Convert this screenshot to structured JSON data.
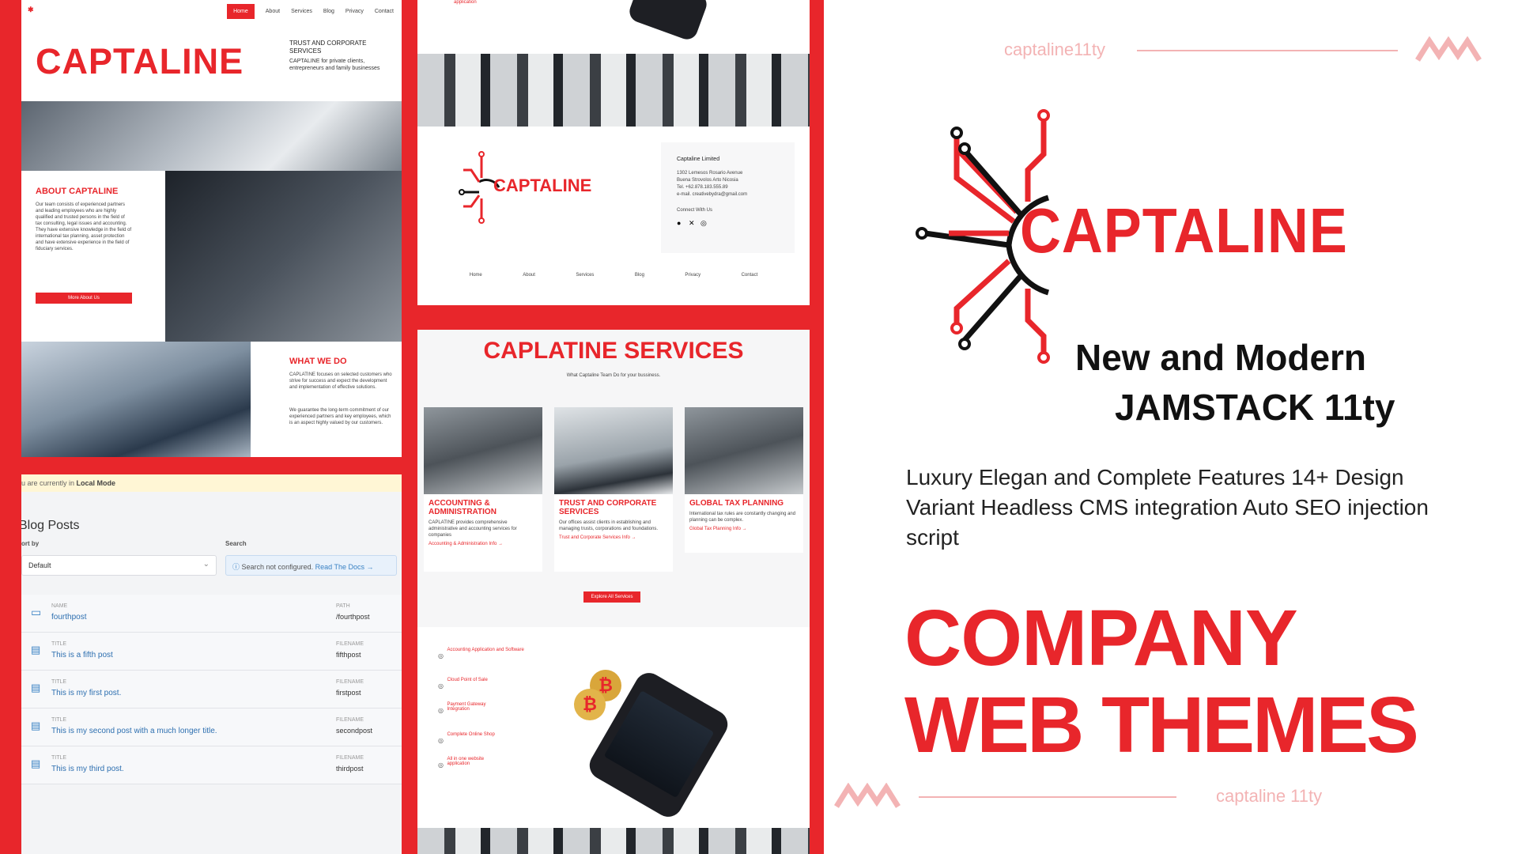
{
  "colors": {
    "brand_red": "#e8262b",
    "faded_red": "#f3b3b4"
  },
  "panel_a": {
    "nav": [
      "Home",
      "About",
      "Services",
      "Blog",
      "Privacy",
      "Contact"
    ],
    "logo_text": "CAPTALINE",
    "trust_title": "TRUST AND CORPORATE SERVICES",
    "trust_sub": "CAPTALINE for private clients, entrepreneurs and family businesses",
    "about_title": "ABOUT CAPTALINE",
    "about_body": "Our team consists of experienced partners and leading employees who are highly qualified and trusted persons in the field of tax consulting, legal issues and accounting. They have extensive knowledge in the field of international tax planning, asset protection and have extensive experience in the field of fiduciary services.",
    "about_button": "More About Us",
    "what_title": "WHAT WE DO",
    "what_body1": "CAPLATINE focuses on selected customers who strive for success and expect the development and implementation of effective solutions.",
    "what_body2": "We guarantee the long-term commitment of our experienced partners and key employees, which is an aspect highly valued by our customers."
  },
  "cms": {
    "notice_prefix": "u are currently in",
    "notice_mode": "Local Mode",
    "heading": "Blog Posts",
    "sort_label": "ort by",
    "sort_value": "Default",
    "search_label": "Search",
    "search_status": "Search not configured.",
    "search_link": "Read The Docs",
    "rows": [
      {
        "k1": "NAME",
        "v1": "fourthpost",
        "k2": "PATH",
        "v2": "/fourthpost",
        "icon": "folder-icon"
      },
      {
        "k1": "TITLE",
        "v1": "This is a fifth post",
        "k2": "FILENAME",
        "v2": "fifthpost",
        "icon": "document-icon"
      },
      {
        "k1": "TITLE",
        "v1": "This is my first post.",
        "k2": "FILENAME",
        "v2": "firstpost",
        "icon": "document-icon"
      },
      {
        "k1": "TITLE",
        "v1": "This is my second post with a much longer title.",
        "k2": "FILENAME",
        "v2": "secondpost",
        "icon": "document-icon"
      },
      {
        "k1": "TITLE",
        "v1": "This is my third post.",
        "k2": "FILENAME",
        "v2": "thirdpost",
        "icon": "document-icon"
      }
    ]
  },
  "panel_b": {
    "top_caption": "application",
    "footer_logo": "CAPTALINE",
    "company": "Captaline Limited",
    "address1": "1302 Lemesos Rosario Avenue",
    "address2": "Buena Strovolos Arto Nicosia",
    "tel": "Tel. +62.878.183.555.89",
    "email": "e-mail. creativebydra@gmail.com",
    "connect": "Connect With Us",
    "footer_nav": [
      "Home",
      "About",
      "Services",
      "Blog",
      "Privacy",
      "Contact"
    ]
  },
  "panel_c": {
    "title": "CAPLATINE SERVICES",
    "subtitle": "What Captaline Team Do for your bussiness.",
    "cards": [
      {
        "title": "ACCOUNTING & ADMINISTRATION",
        "body": "CAPLATINE provides comprehensive administrative and accounting services for companies",
        "link": "Accounting & Administration Info →"
      },
      {
        "title": "TRUST AND CORPORATE SERVICES",
        "body": "Our offices assist clients in establishing and managing trusts, corporations and foundations.",
        "link": "Trust and Corporate Services Info →"
      },
      {
        "title": "GLOBAL TAX PLANNING",
        "body": "International tax rules are constantly changing and planning can be complex.",
        "link": "Global Tax Planning Info →"
      }
    ],
    "button": "Explore All Services",
    "features": [
      "Accounting Application and Software",
      "Cloud Point of Sale",
      "Payment Gateway Integration",
      "Complete Online Shop",
      "All in one website application"
    ]
  },
  "promo": {
    "handle_top": "captaline11ty",
    "handle_bottom": "captaline 11ty",
    "logo_text": "CAPTALINE",
    "tagline1": "New and Modern",
    "tagline2": "JAMSTACK 11ty",
    "description": "Luxury Elegan and Complete Features 14+ Design Variant Headless CMS integration Auto SEO injection script",
    "headline1": "COMPANY",
    "headline2": "WEB THEMES"
  }
}
